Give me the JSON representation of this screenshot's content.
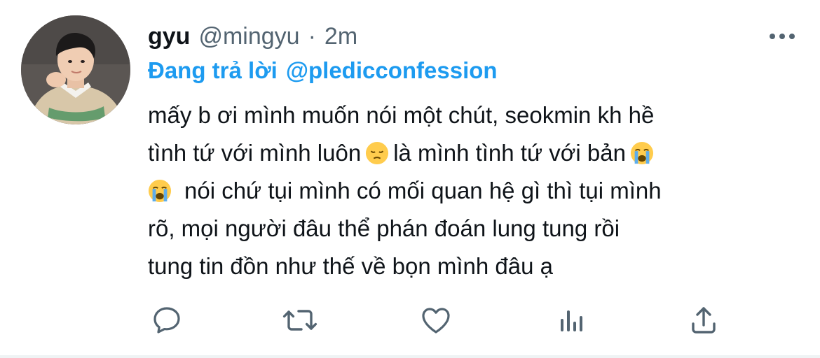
{
  "tweet": {
    "author": {
      "display_name": "gyu",
      "handle": "@mingyu"
    },
    "separator": "·",
    "timestamp": "2m",
    "replying_to": {
      "prefix": "Đang trả lời",
      "handle": "@pledicconfession"
    },
    "body_lines": [
      "mấy b ơi mình muốn nói một chút, seokmin kh hề",
      "tình tứ với mình luôn",
      "là mình tình tứ với bản",
      "nói chứ tụi mình có mối quan hệ gì thì tụi mình",
      "rõ, mọi người đâu thể phán đoán lung tung rồi",
      "tung tin đồn như thế về bọn mình đâu ạ"
    ],
    "emojis": {
      "pensive": "pensive-face-emoji",
      "crying": "loudly-crying-face-emoji"
    }
  },
  "actions": [
    {
      "name": "reply",
      "icon": "speech-bubble-icon"
    },
    {
      "name": "retweet",
      "icon": "retweet-icon"
    },
    {
      "name": "like",
      "icon": "heart-icon"
    },
    {
      "name": "analytics",
      "icon": "bar-chart-icon"
    },
    {
      "name": "share",
      "icon": "share-icon"
    }
  ],
  "colors": {
    "link": "#1d9bf0",
    "secondary_text": "#536471",
    "primary_text": "#0f1419",
    "icon": "#536471"
  }
}
